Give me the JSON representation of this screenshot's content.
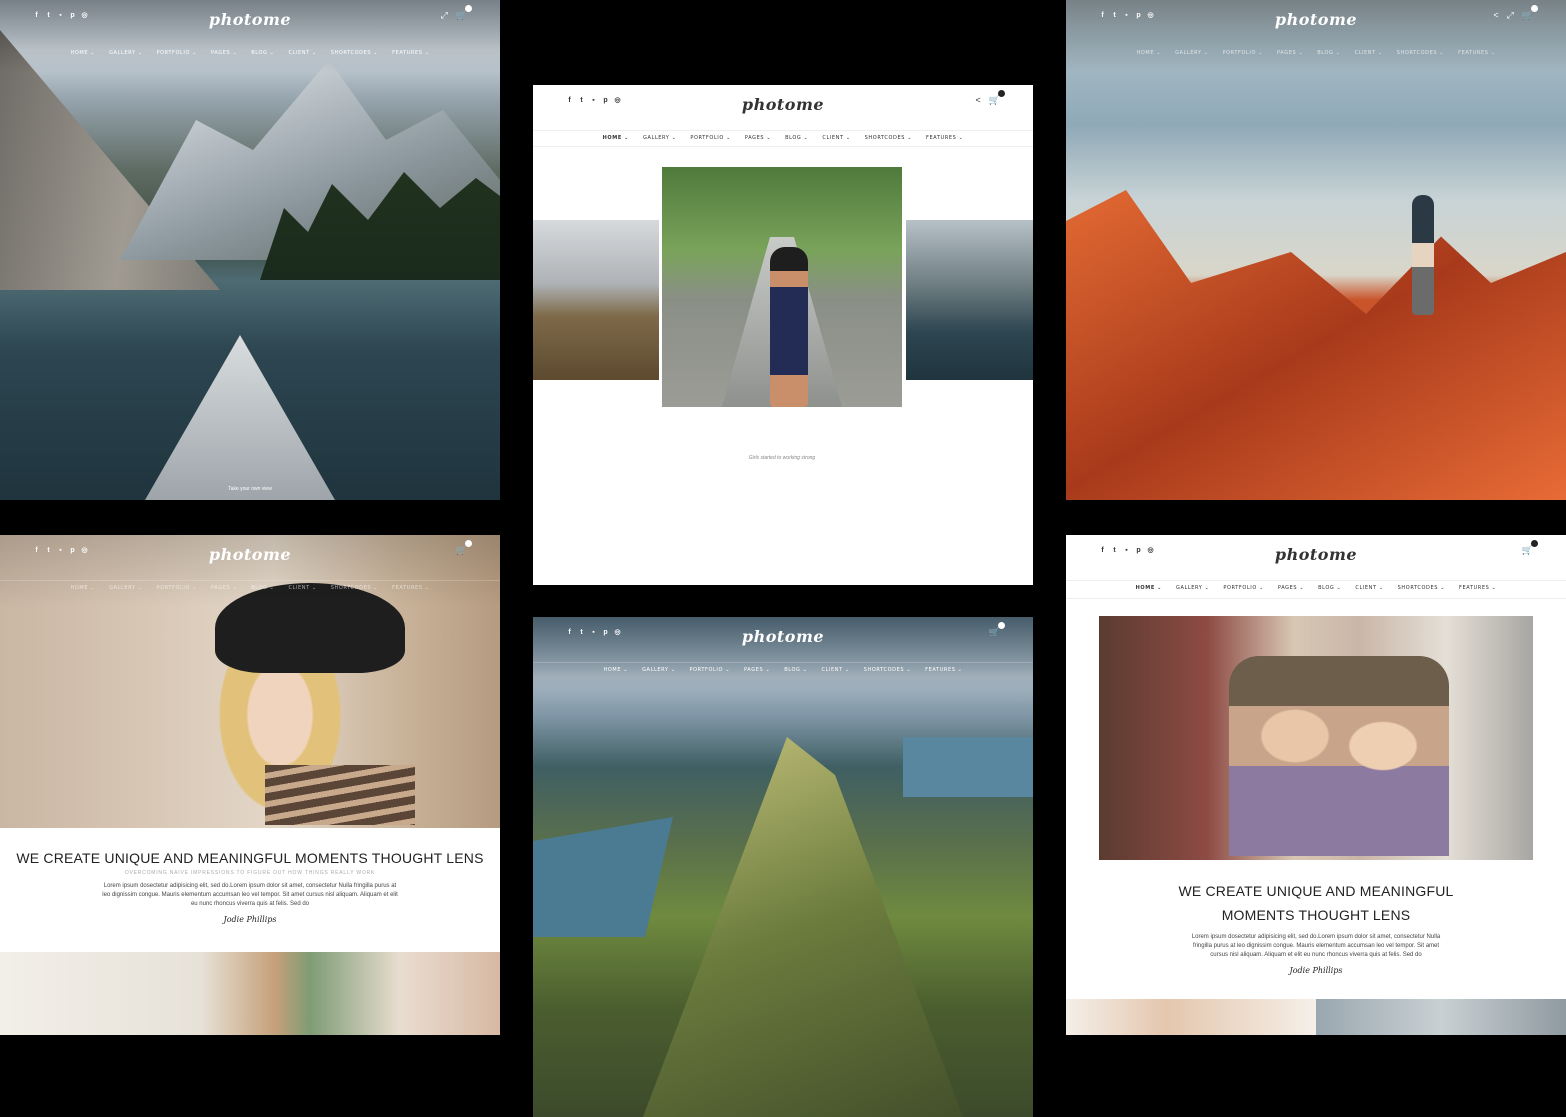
{
  "theme": {
    "logo": "photome",
    "social_icons": [
      "facebook-icon",
      "twitter-icon",
      "flickr-icon",
      "pinterest-icon",
      "instagram-icon"
    ],
    "social_glyphs": [
      "f",
      "t",
      "▪",
      "p",
      "◎"
    ],
    "nav": [
      "HOME ⌄",
      "GALLERY ⌄",
      "PORTFOLIO ⌄",
      "PAGES ⌄",
      "BLOG ⌄",
      "CLIENT ⌄",
      "SHORTCODES ⌄",
      "FEATURES ⌄"
    ],
    "cart_count": "0",
    "expand_glyph": "⤢",
    "share_glyph": "<",
    "cart_glyph": "🛒"
  },
  "panel_mountain": {
    "caption": "Take your own view"
  },
  "panel_gallery": {
    "caption": "Girls started to working strong"
  },
  "panel_girl": {
    "headline": "WE CREATE UNIQUE AND MEANINGFUL MOMENTS THOUGHT LENS",
    "subhead": "OVERCOMING NAIVE IMPRESSIONS TO FIGURE OUT HOW THINGS REALLY WORK",
    "body": "Lorem ipsum dosectetur adipisicing elit, sed do.Lorem ipsum dolor sit amet, consectetur Nulla fringilla purus at leo dignissim congue. Mauris elementum accumsan leo vel tempor. Sit amet cursus nisl aliquam. Aliquam et elit eu nunc rhoncus viverra quis at felis. Sed do",
    "signature": "Jodie Phillips"
  },
  "panel_car": {
    "headline_line1": "WE CREATE UNIQUE AND MEANINGFUL",
    "headline_line2": "MOMENTS THOUGHT LENS",
    "body": "Lorem ipsum dosectetur adipisicing elit, sed do.Lorem ipsum dolor sit amet, consectetur Nulla fringilla purus at leo dignissim congue. Mauris elementum accumsan leo vel tempor. Sit amet cursus nisl aliquam. Aliquam et elit eu nunc rhoncus viverra quis at felis. Sed do",
    "signature": "Jodie Phillips"
  }
}
